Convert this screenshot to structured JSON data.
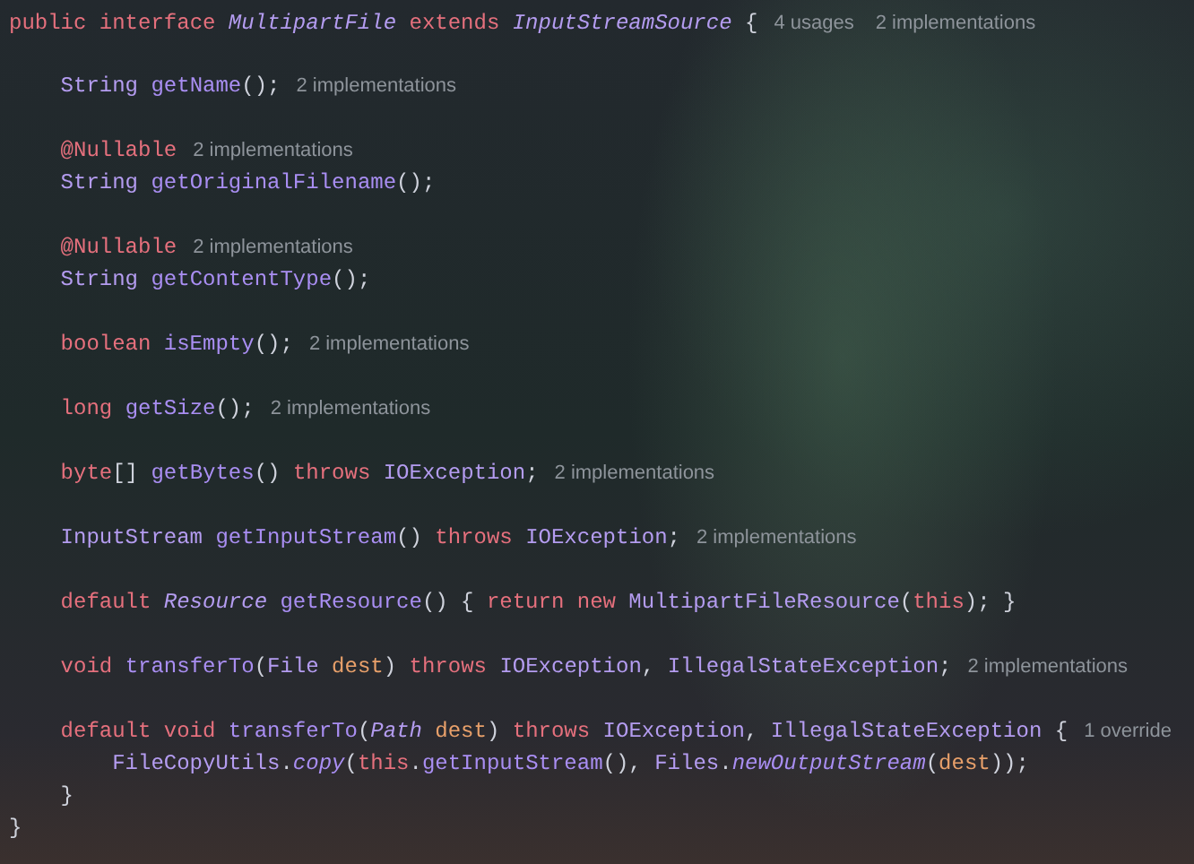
{
  "editor": {
    "header": {
      "tokens": [
        {
          "kind": "keyword",
          "text": "public interface "
        },
        {
          "kind": "type-italic",
          "text": "MultipartFile"
        },
        {
          "kind": "keyword",
          "text": " extends "
        },
        {
          "kind": "type-italic",
          "text": "InputStreamSource"
        },
        {
          "kind": "plain",
          "text": " {"
        }
      ],
      "hints": [
        "4 usages",
        "2 implementations"
      ]
    },
    "members": [
      {
        "lines": [
          {
            "tokens": [
              {
                "kind": "type",
                "text": "String "
              },
              {
                "kind": "method",
                "text": "getName"
              },
              {
                "kind": "plain",
                "text": "();"
              }
            ],
            "hints": [
              "2 implementations"
            ]
          }
        ]
      },
      {
        "lines": [
          {
            "tokens": [
              {
                "kind": "keyword",
                "text": "@Nullable"
              }
            ],
            "hints": [
              "2 implementations"
            ]
          },
          {
            "tokens": [
              {
                "kind": "type",
                "text": "String "
              },
              {
                "kind": "method",
                "text": "getOriginalFilename"
              },
              {
                "kind": "plain",
                "text": "();"
              }
            ]
          }
        ]
      },
      {
        "lines": [
          {
            "tokens": [
              {
                "kind": "keyword",
                "text": "@Nullable"
              }
            ],
            "hints": [
              "2 implementations"
            ]
          },
          {
            "tokens": [
              {
                "kind": "type",
                "text": "String "
              },
              {
                "kind": "method",
                "text": "getContentType"
              },
              {
                "kind": "plain",
                "text": "();"
              }
            ]
          }
        ]
      },
      {
        "lines": [
          {
            "tokens": [
              {
                "kind": "keyword",
                "text": "boolean "
              },
              {
                "kind": "method",
                "text": "isEmpty"
              },
              {
                "kind": "plain",
                "text": "();"
              }
            ],
            "hints": [
              "2 implementations"
            ]
          }
        ]
      },
      {
        "lines": [
          {
            "tokens": [
              {
                "kind": "keyword",
                "text": "long "
              },
              {
                "kind": "method",
                "text": "getSize"
              },
              {
                "kind": "plain",
                "text": "();"
              }
            ],
            "hints": [
              "2 implementations"
            ]
          }
        ]
      },
      {
        "lines": [
          {
            "tokens": [
              {
                "kind": "keyword",
                "text": "byte"
              },
              {
                "kind": "plain",
                "text": "[] "
              },
              {
                "kind": "method",
                "text": "getBytes"
              },
              {
                "kind": "plain",
                "text": "() "
              },
              {
                "kind": "keyword",
                "text": "throws "
              },
              {
                "kind": "type",
                "text": "IOException"
              },
              {
                "kind": "plain",
                "text": ";"
              }
            ],
            "hints": [
              "2 implementations"
            ]
          }
        ]
      },
      {
        "lines": [
          {
            "tokens": [
              {
                "kind": "type",
                "text": "InputStream "
              },
              {
                "kind": "method",
                "text": "getInputStream"
              },
              {
                "kind": "plain",
                "text": "() "
              },
              {
                "kind": "keyword",
                "text": "throws "
              },
              {
                "kind": "type",
                "text": "IOException"
              },
              {
                "kind": "plain",
                "text": ";"
              }
            ],
            "hints": [
              "2 implementations"
            ]
          }
        ]
      },
      {
        "lines": [
          {
            "tokens": [
              {
                "kind": "keyword",
                "text": "default "
              },
              {
                "kind": "type-italic",
                "text": "Resource "
              },
              {
                "kind": "method",
                "text": "getResource"
              },
              {
                "kind": "plain",
                "text": "() { "
              },
              {
                "kind": "keyword",
                "text": "return new "
              },
              {
                "kind": "type",
                "text": "MultipartFileResource"
              },
              {
                "kind": "plain",
                "text": "("
              },
              {
                "kind": "keyword",
                "text": "this"
              },
              {
                "kind": "plain",
                "text": "); }"
              }
            ]
          }
        ]
      },
      {
        "lines": [
          {
            "tokens": [
              {
                "kind": "keyword",
                "text": "void "
              },
              {
                "kind": "method",
                "text": "transferTo"
              },
              {
                "kind": "plain",
                "text": "("
              },
              {
                "kind": "type",
                "text": "File "
              },
              {
                "kind": "param",
                "text": "dest"
              },
              {
                "kind": "plain",
                "text": ") "
              },
              {
                "kind": "keyword",
                "text": "throws "
              },
              {
                "kind": "type",
                "text": "IOException"
              },
              {
                "kind": "plain",
                "text": ", "
              },
              {
                "kind": "type",
                "text": "IllegalStateException"
              },
              {
                "kind": "plain",
                "text": ";"
              }
            ],
            "hints": [
              "2 implementations"
            ]
          }
        ]
      },
      {
        "lines": [
          {
            "tokens": [
              {
                "kind": "keyword",
                "text": "default void "
              },
              {
                "kind": "method",
                "text": "transferTo"
              },
              {
                "kind": "plain",
                "text": "("
              },
              {
                "kind": "type-italic",
                "text": "Path "
              },
              {
                "kind": "param",
                "text": "dest"
              },
              {
                "kind": "plain",
                "text": ") "
              },
              {
                "kind": "keyword",
                "text": "throws "
              },
              {
                "kind": "type",
                "text": "IOException"
              },
              {
                "kind": "plain",
                "text": ", "
              },
              {
                "kind": "type",
                "text": "IllegalStateException"
              },
              {
                "kind": "plain",
                "text": " {"
              }
            ],
            "hints": [
              "1 override"
            ],
            "children": [
              {
                "tokens": [
                  {
                    "kind": "type",
                    "text": "FileCopyUtils"
                  },
                  {
                    "kind": "plain",
                    "text": "."
                  },
                  {
                    "kind": "method-italic",
                    "text": "copy"
                  },
                  {
                    "kind": "plain",
                    "text": "("
                  },
                  {
                    "kind": "keyword",
                    "text": "this"
                  },
                  {
                    "kind": "plain",
                    "text": "."
                  },
                  {
                    "kind": "method",
                    "text": "getInputStream"
                  },
                  {
                    "kind": "plain",
                    "text": "(), "
                  },
                  {
                    "kind": "type",
                    "text": "Files"
                  },
                  {
                    "kind": "plain",
                    "text": "."
                  },
                  {
                    "kind": "method-italic",
                    "text": "newOutputStream"
                  },
                  {
                    "kind": "plain",
                    "text": "("
                  },
                  {
                    "kind": "param",
                    "text": "dest"
                  },
                  {
                    "kind": "plain",
                    "text": "));"
                  }
                ]
              }
            ]
          },
          {
            "tokens": [
              {
                "kind": "plain",
                "text": "}"
              }
            ]
          }
        ]
      }
    ],
    "closing": {
      "tokens": [
        {
          "kind": "plain",
          "text": "}"
        }
      ]
    }
  }
}
